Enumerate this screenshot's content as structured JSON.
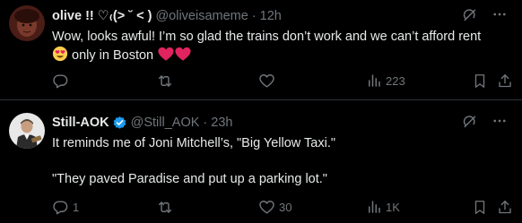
{
  "tweets": [
    {
      "author": "olive !! ♡₍(> ˘ < )",
      "handle": "@oliveisameme",
      "separator": "·",
      "time": "12h",
      "text_line1": "Wow, looks awful! I’m so glad the trains don’t work and we can’t afford rent",
      "text_line2": "only in Boston",
      "replies": "",
      "retweets": "",
      "likes": "",
      "views": "223",
      "verified": false
    },
    {
      "author": "Still-AOK",
      "handle": "@Still_AOK",
      "separator": "·",
      "time": "23h",
      "text_line1": "It reminds me of Joni Mitchell’s, \"Big Yellow Taxi.\"",
      "text_line2": "\"They paved Paradise and put up a parking lot.\"",
      "replies": "1",
      "retweets": "",
      "likes": "30",
      "views": "1K",
      "verified": true
    }
  ],
  "icons": {
    "grok": "grok-icon",
    "more": "more-dots-icon",
    "reply": "reply-icon",
    "retweet": "retweet-icon",
    "like": "heart-icon",
    "views": "views-chart-icon",
    "bookmark": "bookmark-icon",
    "share": "share-icon"
  },
  "colors": {
    "background": "#000000",
    "text": "#e7e9ea",
    "muted": "#71767b",
    "divider": "#2f3336",
    "verified": "#1d9bf0",
    "heart": "#e0245e"
  }
}
